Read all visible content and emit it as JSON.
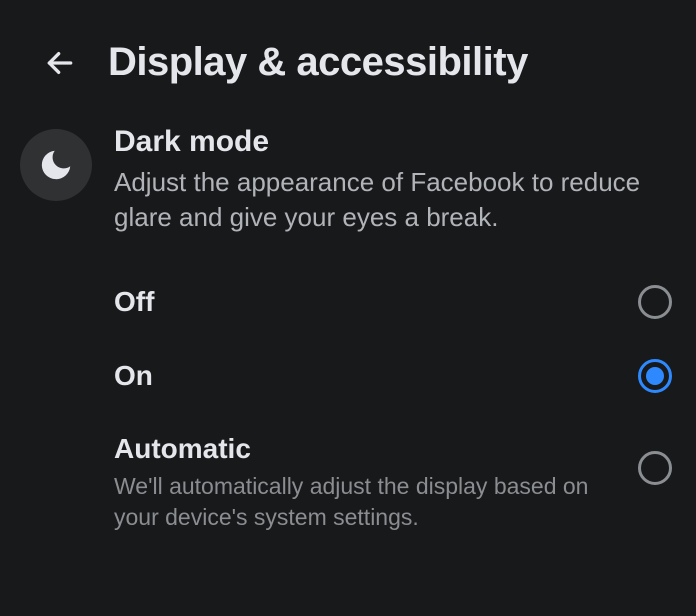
{
  "header": {
    "title": "Display & accessibility"
  },
  "section": {
    "title": "Dark mode",
    "description": "Adjust the appearance of Facebook to reduce glare and give your eyes a break."
  },
  "options": [
    {
      "label": "Off",
      "sublabel": null,
      "selected": false
    },
    {
      "label": "On",
      "sublabel": null,
      "selected": true
    },
    {
      "label": "Automatic",
      "sublabel": "We'll automatically adjust the display based on your device's system settings.",
      "selected": false
    }
  ],
  "colors": {
    "accent": "#2e89ff",
    "background": "#18191a",
    "textPrimary": "#e4e6eb",
    "textSecondary": "#b0b3b8"
  }
}
